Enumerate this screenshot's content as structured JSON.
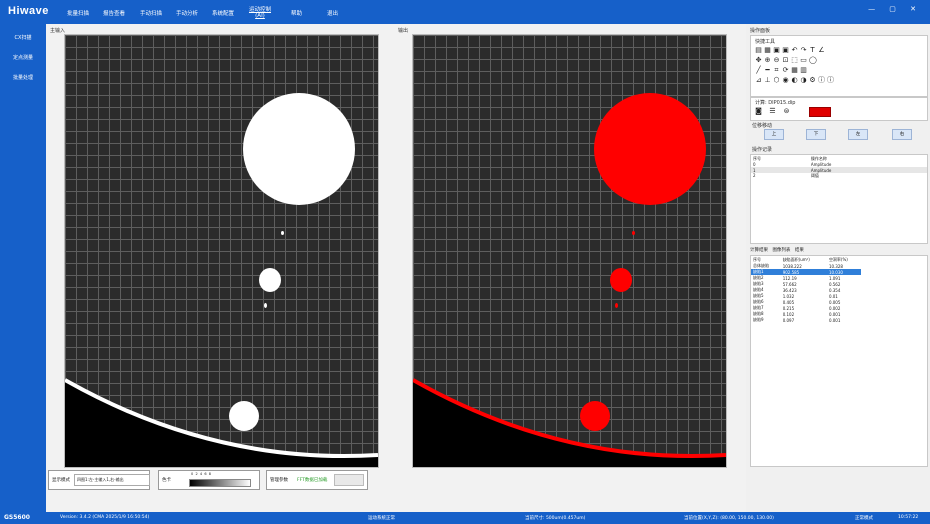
{
  "app": {
    "logo": "Hiwave"
  },
  "menu": [
    "批量扫描",
    "报告查看",
    "手动扫描",
    "手动分析",
    "系统配置",
    "运动控制(AI)",
    "帮助",
    "退出"
  ],
  "window_controls": "— ▢ ✕",
  "sidebar": {
    "items": [
      "CX扫描",
      "定点测量",
      "批量处理"
    ]
  },
  "panels": {
    "input_label": "主输入",
    "output_label": "输出"
  },
  "bottom": {
    "display_mode_label": "显示模式",
    "display_mode_value": "四图1:左-主输入1,右-输出",
    "colorbar_label": "色卡",
    "colorbar_ticks": "0  2  4  6  8",
    "param_label": "管理参数",
    "param_value": "FFT数据已加载"
  },
  "right": {
    "title": "操作面板",
    "quick_tools": "快捷工具",
    "compute_label": "计算: DIP015.dip",
    "compute_button": "",
    "move_title": "位移移动",
    "directions": [
      "上",
      "下",
      "左",
      "右"
    ],
    "ops_title": "操作记录",
    "ops_headers": [
      "序号",
      "操作名称"
    ],
    "ops_rows": [
      [
        "0",
        "Amplitude"
      ],
      [
        "1",
        "Amplitude"
      ],
      [
        "2",
        "阈值"
      ]
    ],
    "tabs": [
      "计算结果",
      "图像列表",
      "结果"
    ],
    "results_headers": [
      "序号",
      "缺陷面积(um²)",
      "空洞率(%)"
    ],
    "results_rows": [
      [
        "总体缺陷",
        "1038.222",
        "10.328"
      ],
      [
        "缺陷1",
        "902.585",
        "10.030"
      ],
      [
        "缺陷2",
        "112.19",
        "1.091"
      ],
      [
        "缺陷3",
        "57.662",
        "0.562"
      ],
      [
        "缺陷4",
        "36.423",
        "0.354"
      ],
      [
        "缺陷5",
        "1.032",
        "0.01"
      ],
      [
        "缺陷6",
        "0.405",
        "0.005"
      ],
      [
        "缺陷7",
        "0.215",
        "0.002"
      ],
      [
        "缺陷8",
        "0.102",
        "0.001"
      ],
      [
        "缺陷9",
        "0.097",
        "0.001"
      ]
    ]
  },
  "status": {
    "device": "GS5600",
    "version": "Version: 3.4.2 (CMA 2025/1/9 16:50:54)",
    "system": "运动系统正常",
    "scale": "当前尺寸: 500um(0.457um)",
    "position": "当前位置(X,Y,Z): (80.00, 150.00, 130.00)",
    "mode": "正常模式",
    "time": "10:57:22"
  },
  "colors": {
    "accent": "#1660c9",
    "defect": "#ff0000"
  }
}
